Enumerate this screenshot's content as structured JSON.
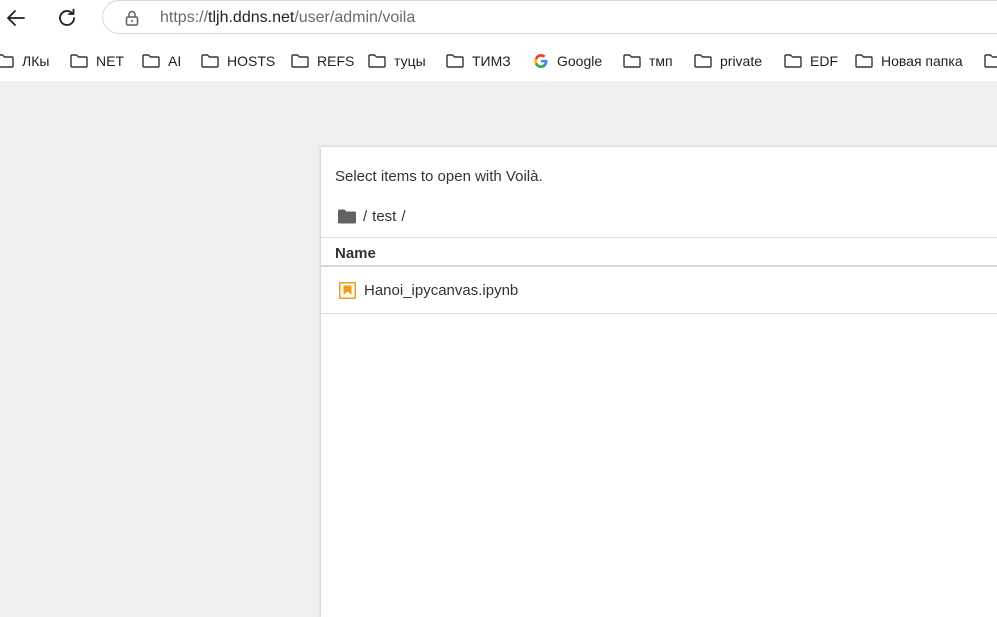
{
  "browser": {
    "url_scheme": "https://",
    "url_host": "tljh.ddns.net",
    "url_path": "/user/admin/voila"
  },
  "bookmarks": [
    {
      "label": "ЛКы",
      "icon": "folder-icon"
    },
    {
      "label": "NET",
      "icon": "folder-icon"
    },
    {
      "label": "AI",
      "icon": "folder-icon"
    },
    {
      "label": "HOSTS",
      "icon": "folder-icon"
    },
    {
      "label": "REFS",
      "icon": "folder-icon"
    },
    {
      "label": "туцы",
      "icon": "folder-icon"
    },
    {
      "label": "ТИМЗ",
      "icon": "folder-icon"
    },
    {
      "label": "Google",
      "icon": "google-icon"
    },
    {
      "label": "тмп",
      "icon": "folder-icon"
    },
    {
      "label": "private",
      "icon": "folder-icon"
    },
    {
      "label": "EDF",
      "icon": "folder-icon"
    },
    {
      "label": "Новая папка",
      "icon": "folder-icon"
    }
  ],
  "voila": {
    "instructions": "Select items to open with Voilà.",
    "breadcrumb": {
      "root_sep": "/",
      "folder": "test",
      "trail_sep": "/"
    },
    "columns": {
      "name": "Name"
    },
    "files": [
      {
        "name": "Hanoi_ipycanvas.ipynb",
        "icon": "notebook-icon"
      }
    ]
  },
  "colors": {
    "page_background": "#f0f0f0",
    "notebook_icon": "#f39b1a",
    "text": "#333333"
  }
}
